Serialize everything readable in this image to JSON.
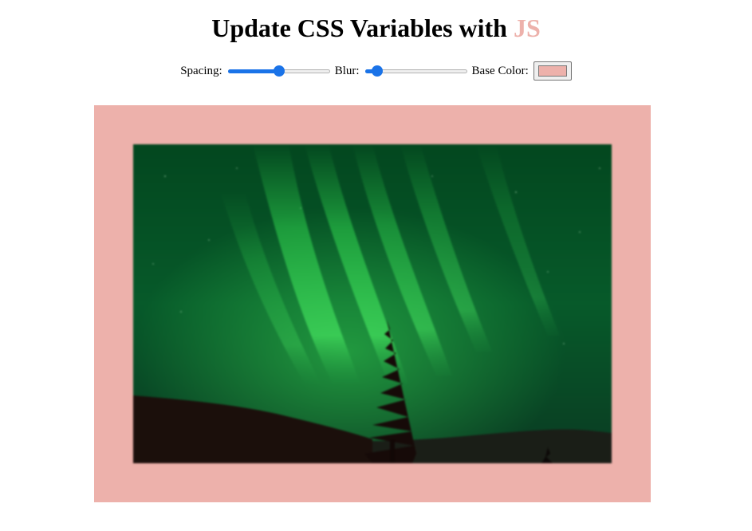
{
  "page": {
    "title_main": "Update CSS Variables with ",
    "title_highlight": "JS"
  },
  "controls": {
    "spacing_label": "Spacing:",
    "spacing_value": 0.5,
    "blur_label": "Blur:",
    "blur_value": 0.12,
    "base_color_label": "Base Color:",
    "base_color": "#edb1ab"
  },
  "image": {
    "subject": "aurora-borealis-night-sky-photo"
  },
  "colors": {
    "accent": "#edb1ab",
    "slider_blue": "#1a73e8"
  }
}
